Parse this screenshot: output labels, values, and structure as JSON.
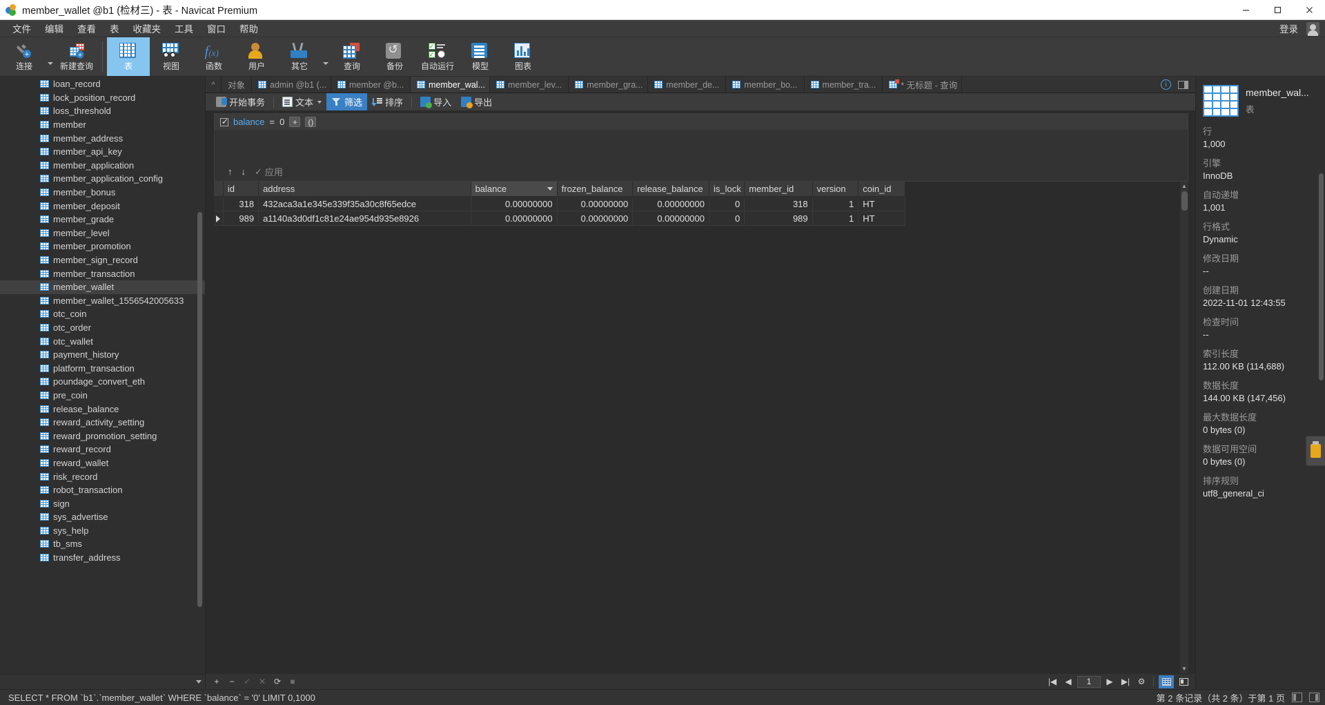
{
  "window": {
    "title": "member_wallet @b1 (检材三) - 表 - Navicat Premium",
    "minimize": "—",
    "maximize": "▢",
    "close": "✕"
  },
  "menubar": {
    "items": [
      "文件",
      "编辑",
      "查看",
      "表",
      "收藏夹",
      "工具",
      "窗口",
      "帮助"
    ],
    "login": "登录"
  },
  "ribbon": {
    "items": [
      {
        "label": "连接",
        "icon": "connection-icon",
        "caret": true
      },
      {
        "label": "新建查询",
        "icon": "new-query-icon",
        "caret": false
      },
      {
        "label": "表",
        "icon": "table-icon",
        "active": true
      },
      {
        "label": "视图",
        "icon": "view-icon"
      },
      {
        "label": "函数",
        "icon": "function-icon"
      },
      {
        "label": "用户",
        "icon": "user-icon"
      },
      {
        "label": "其它",
        "icon": "other-tools-icon",
        "caret": true
      },
      {
        "label": "查询",
        "icon": "query-icon"
      },
      {
        "label": "备份",
        "icon": "backup-icon"
      },
      {
        "label": "自动运行",
        "icon": "automation-icon"
      },
      {
        "label": "模型",
        "icon": "model-icon"
      },
      {
        "label": "图表",
        "icon": "chart-icon"
      }
    ]
  },
  "sidebar": {
    "tables": [
      "loan_record",
      "lock_position_record",
      "loss_threshold",
      "member",
      "member_address",
      "member_api_key",
      "member_application",
      "member_application_config",
      "member_bonus",
      "member_deposit",
      "member_grade",
      "member_level",
      "member_promotion",
      "member_sign_record",
      "member_transaction",
      "member_wallet",
      "member_wallet_1556542005633",
      "otc_coin",
      "otc_order",
      "otc_wallet",
      "payment_history",
      "platform_transaction",
      "poundage_convert_eth",
      "pre_coin",
      "release_balance",
      "reward_activity_setting",
      "reward_promotion_setting",
      "reward_record",
      "reward_wallet",
      "risk_record",
      "robot_transaction",
      "sign",
      "sys_advertise",
      "sys_help",
      "tb_sms",
      "transfer_address"
    ],
    "selected": "member_wallet"
  },
  "tabs": {
    "objects_label": "对象",
    "items": [
      {
        "label": "admin @b1 (...",
        "active": false,
        "type": "table"
      },
      {
        "label": "member @b...",
        "active": false,
        "type": "table"
      },
      {
        "label": "member_wal...",
        "active": true,
        "type": "table"
      },
      {
        "label": "member_lev...",
        "active": false,
        "type": "table"
      },
      {
        "label": "member_gra...",
        "active": false,
        "type": "table"
      },
      {
        "label": "member_de...",
        "active": false,
        "type": "table"
      },
      {
        "label": "member_bo...",
        "active": false,
        "type": "table"
      },
      {
        "label": "member_tra...",
        "active": false,
        "type": "table"
      },
      {
        "label": "* 无标题 - 查询",
        "active": false,
        "type": "query"
      }
    ]
  },
  "grid_toolbar": {
    "begin_transaction": "开始事务",
    "text": "文本",
    "filter": "筛选",
    "sort": "排序",
    "import": "导入",
    "export": "导出"
  },
  "filter": {
    "field": "balance",
    "operator": "=",
    "value": "0",
    "add_button": "+",
    "group_button": "()",
    "up_arrow": "↑",
    "down_arrow": "↓",
    "apply": "应用",
    "apply_check": "✓"
  },
  "table": {
    "columns": [
      "id",
      "address",
      "balance",
      "frozen_balance",
      "release_balance",
      "is_lock",
      "member_id",
      "version",
      "coin_id"
    ],
    "sorted_column": "balance",
    "rows": [
      {
        "current": false,
        "id": "318",
        "address": "432aca3a1e345e339f35a30c8f65edce",
        "balance": "0.00000000",
        "frozen_balance": "0.00000000",
        "release_balance": "0.00000000",
        "is_lock": "0",
        "member_id": "318",
        "version": "1",
        "coin_id": "HT",
        "balance_selected": false
      },
      {
        "current": true,
        "id": "989",
        "address": "a1140a3d0df1c81e24ae954d935e8926",
        "balance": "0.00000000",
        "frozen_balance": "0.00000000",
        "release_balance": "0.00000000",
        "is_lock": "0",
        "member_id": "989",
        "version": "1",
        "coin_id": "HT",
        "balance_selected": true
      }
    ]
  },
  "grid_footer": {
    "add_row": "+",
    "delete_row": "−",
    "confirm": "✓",
    "cancel": "✕",
    "refresh": "⟳",
    "stop": "■",
    "first_page": "|◀",
    "prev_page": "◀",
    "page_number": "1",
    "next_page": "▶",
    "last_page": "▶|",
    "settings": "⚙"
  },
  "info_panel": {
    "title": "member_wal...",
    "subtitle": "表",
    "fields": [
      {
        "label": "行",
        "value": "1,000"
      },
      {
        "label": "引擎",
        "value": "InnoDB"
      },
      {
        "label": "自动递增",
        "value": "1,001"
      },
      {
        "label": "行格式",
        "value": "Dynamic"
      },
      {
        "label": "修改日期",
        "value": "--"
      },
      {
        "label": "创建日期",
        "value": "2022-11-01 12:43:55"
      },
      {
        "label": "检查时间",
        "value": "--"
      },
      {
        "label": "索引长度",
        "value": "112.00 KB (114,688)"
      },
      {
        "label": "数据长度",
        "value": "144.00 KB (147,456)"
      },
      {
        "label": "最大数据长度",
        "value": "0 bytes (0)"
      },
      {
        "label": "数据可用空间",
        "value": "0 bytes (0)"
      },
      {
        "label": "排序规则",
        "value": "utf8_general_ci"
      }
    ]
  },
  "statusbar": {
    "sql": "SELECT * FROM `b1`.`member_wallet` WHERE `balance` = '0' LIMIT 0,1000",
    "record_info": "第 2 条记录（共 2 条）于第 1 页"
  }
}
